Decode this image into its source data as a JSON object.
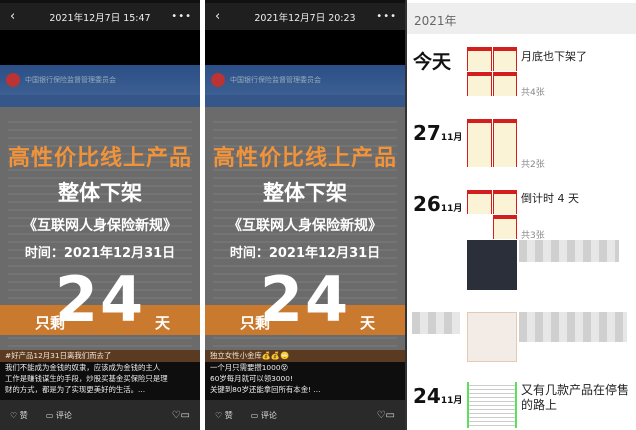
{
  "posts": [
    {
      "timestamp": "2021年12月7日 15:47",
      "banner": "中国银行保险监督管理委员会",
      "headline": "高性价比线上产品",
      "subhead": "整体下架",
      "regulation": "《互联网人身保险新规》",
      "time": "时间：2021年12月31日",
      "remain_prefix": "只剩",
      "remain_num": "24",
      "remain_suffix": "天",
      "caption_title": "#好产品12月31日离我们而去了",
      "caption_lines": [
        "我们不能成为金钱的奴隶，应该成为金钱的主人",
        "工作是赚钱谋生的手段，炒股买基金买保险只是理",
        "财的方式，都是为了实现更美好的生活。..."
      ]
    },
    {
      "timestamp": "2021年12月7日 20:23",
      "banner": "中国银行保险监督管理委员会",
      "headline": "高性价比线上产品",
      "subhead": "整体下架",
      "regulation": "《互联网人身保险新规》",
      "time": "时间：2021年12月31日",
      "remain_prefix": "只剩",
      "remain_num": "24",
      "remain_suffix": "天",
      "caption_title": "独立女性小金库💰💰🙄",
      "caption_lines": [
        "一个月只需要攒1000😵",
        "60岁每月就可以领3000!",
        "关键到80岁还能拿回所有本金! ..."
      ]
    }
  ],
  "actions": {
    "like": "赞",
    "comment": "评论",
    "back_icon": "‹",
    "more_icon": "•••",
    "heart": "♡",
    "bubble": "▭"
  },
  "timeline": {
    "year": "2021年",
    "entries": [
      {
        "day": "今天",
        "month": "",
        "text": "月底也下架了",
        "count": "共4张"
      },
      {
        "day": "27",
        "month": "11月",
        "text": "",
        "count": "共2张"
      },
      {
        "day": "26",
        "month": "11月",
        "text": "倒计时 4 天",
        "count": "共3张"
      },
      {
        "day": "24",
        "month": "11月",
        "text": "又有几款产品在停售的路上",
        "count": ""
      }
    ]
  }
}
